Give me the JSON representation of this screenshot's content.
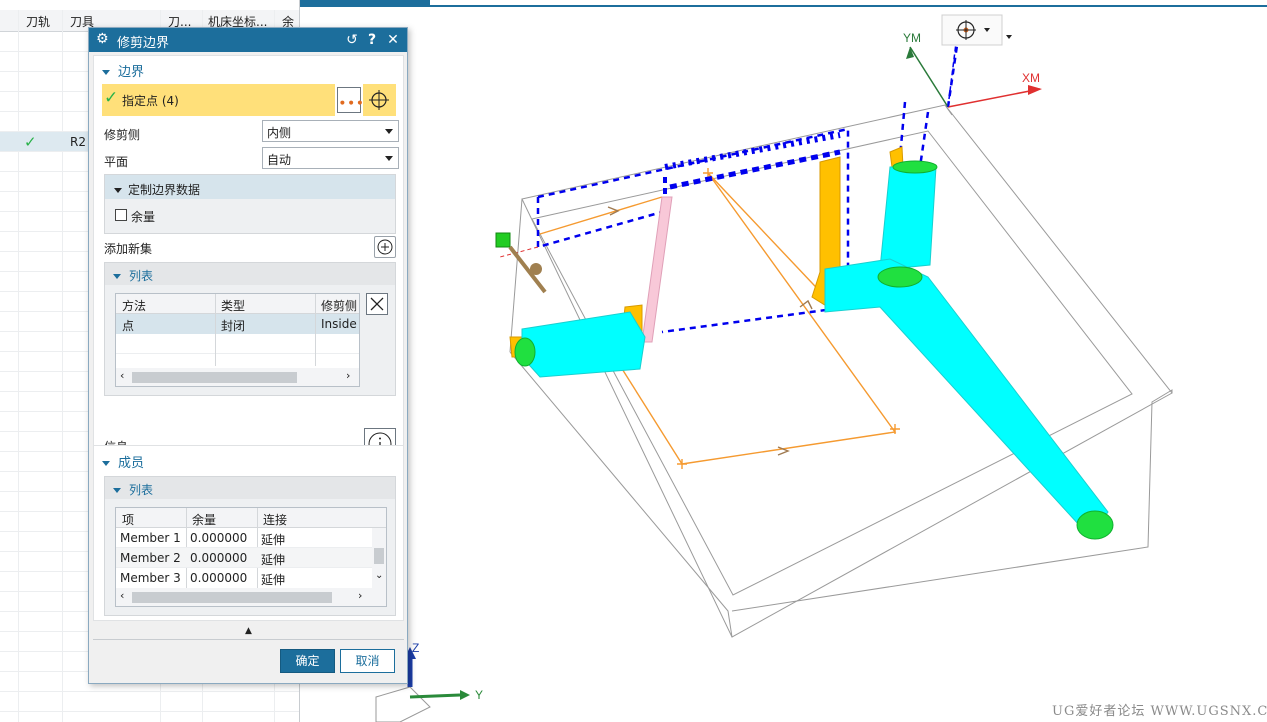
{
  "nav": {
    "headers": [
      "刀轨",
      "刀具",
      "刀...",
      "机床坐标...",
      "余"
    ],
    "selected_row": {
      "check": "✓",
      "tool": "R2"
    }
  },
  "dialog": {
    "title": "修剪边界",
    "title_buttons": {
      "reset": "↺",
      "help": "?",
      "close": "✕"
    },
    "boundary_section": "边界",
    "specify_points": "指定点 (4)",
    "trim_side_label": "修剪侧",
    "trim_side_value": "内侧",
    "plane_label": "平面",
    "plane_value": "自动",
    "custom_boundary_data": "定制边界数据",
    "allowance_label": "余量",
    "add_new_set": "添加新集",
    "list_heading": "列表",
    "list_columns": [
      "方法",
      "类型",
      "修剪侧"
    ],
    "list_rows": [
      {
        "method": "点",
        "type": "封闭",
        "trim": "Inside"
      }
    ],
    "info_label": "信息",
    "members_section": "成员",
    "members_list_heading": "列表",
    "member_columns": [
      "项",
      "余量",
      "连接"
    ],
    "members": [
      {
        "item": "Member 1",
        "allowance": "0.000000",
        "connect": "延伸"
      },
      {
        "item": "Member 2",
        "allowance": "0.000000",
        "connect": "延伸"
      },
      {
        "item": "Member 3",
        "allowance": "0.000000",
        "connect": "延伸"
      }
    ],
    "ok_label": "确定",
    "cancel_label": "取消"
  },
  "viewport": {
    "axis_labels": {
      "ym": "YM",
      "xm": "XM",
      "z": "Z",
      "y": "Y"
    }
  },
  "watermark": "UG爱好者论坛 WWW.UGSNX.COM",
  "colors": {
    "accent": "#1c6e9c",
    "selection_yellow": "#ffe07a",
    "tool_path_cyan": "#00ffff",
    "tool_path_orange": "#ffc000",
    "boundary_blue": "#0000ee",
    "check_green": "#2ab24a"
  }
}
